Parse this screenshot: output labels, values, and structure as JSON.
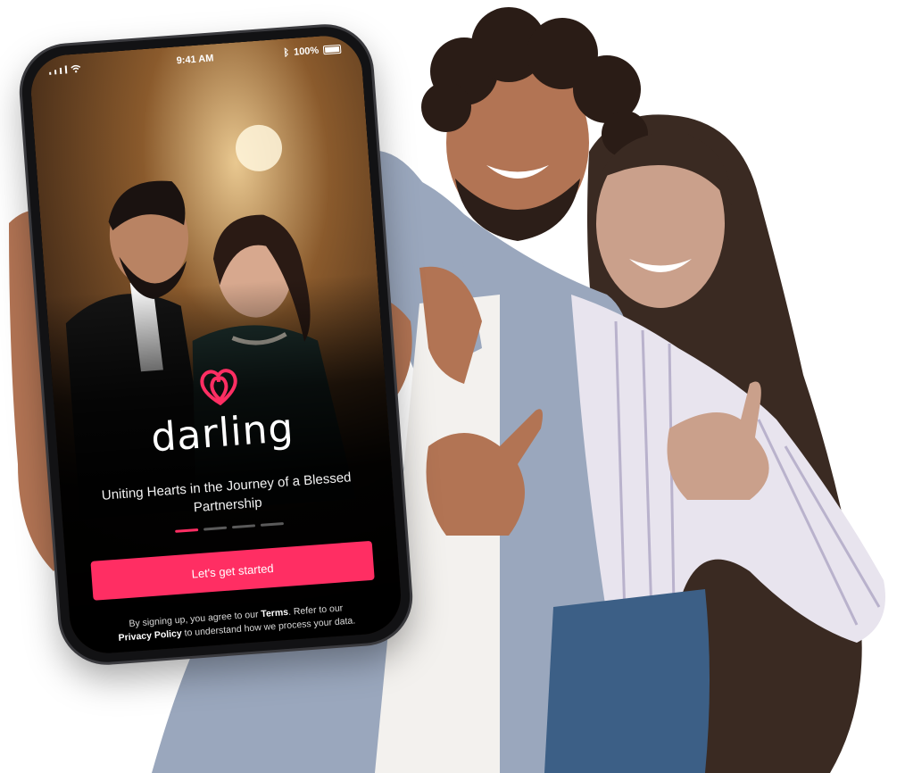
{
  "status_bar": {
    "time": "9:41 AM",
    "battery": "100%",
    "icons": [
      "signal-icon",
      "wifi-icon",
      "bluetooth-icon",
      "battery-icon"
    ]
  },
  "app": {
    "name": "darling",
    "logo_icon": "heart-logo-icon",
    "tagline": "Uniting Hearts in the Journey of a Blessed Partnership",
    "carousel": {
      "total": 4,
      "active": 1
    },
    "cta_label": "Let's get started",
    "legal": {
      "p1": "By signing up, you agree to our",
      "terms": "Terms",
      "p2": ". Refer to our",
      "privacy": "Privacy Policy",
      "p3": "to understand how we process your data."
    }
  },
  "colors": {
    "accent": "#ff2e63",
    "screen_bg": "#000000",
    "page_bg": "#ffffff"
  }
}
